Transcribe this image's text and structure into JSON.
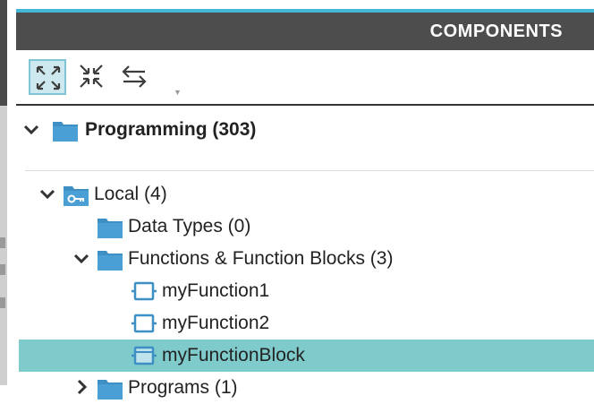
{
  "panel": {
    "title": "COMPONENTS"
  },
  "toolbar": {
    "expand_all_icon": "expand-arrows-icon",
    "collapse_all_icon": "collapse-arrows-icon",
    "swap_icon": "swap-arrows-icon"
  },
  "tree": {
    "root": {
      "label": "Programming (303)",
      "icon": "folder-icon"
    },
    "local": {
      "label": "Local (4)",
      "icon": "local-library-icon"
    },
    "data_types": {
      "label": "Data Types (0)",
      "icon": "folder-icon"
    },
    "functions": {
      "label": "Functions & Function Blocks (3)",
      "icon": "folder-icon"
    },
    "fn1": {
      "label": "myFunction1",
      "icon": "function-icon"
    },
    "fn2": {
      "label": "myFunction2",
      "icon": "function-icon"
    },
    "fb": {
      "label": "myFunctionBlock",
      "icon": "function-block-icon"
    },
    "programs": {
      "label": "Programs (1)",
      "icon": "folder-icon"
    }
  },
  "colors": {
    "accent": "#45b6d6",
    "header_bg": "#4d4d4d",
    "selection": "#7fcbcc",
    "icon_blue": "#3e8fc4"
  }
}
